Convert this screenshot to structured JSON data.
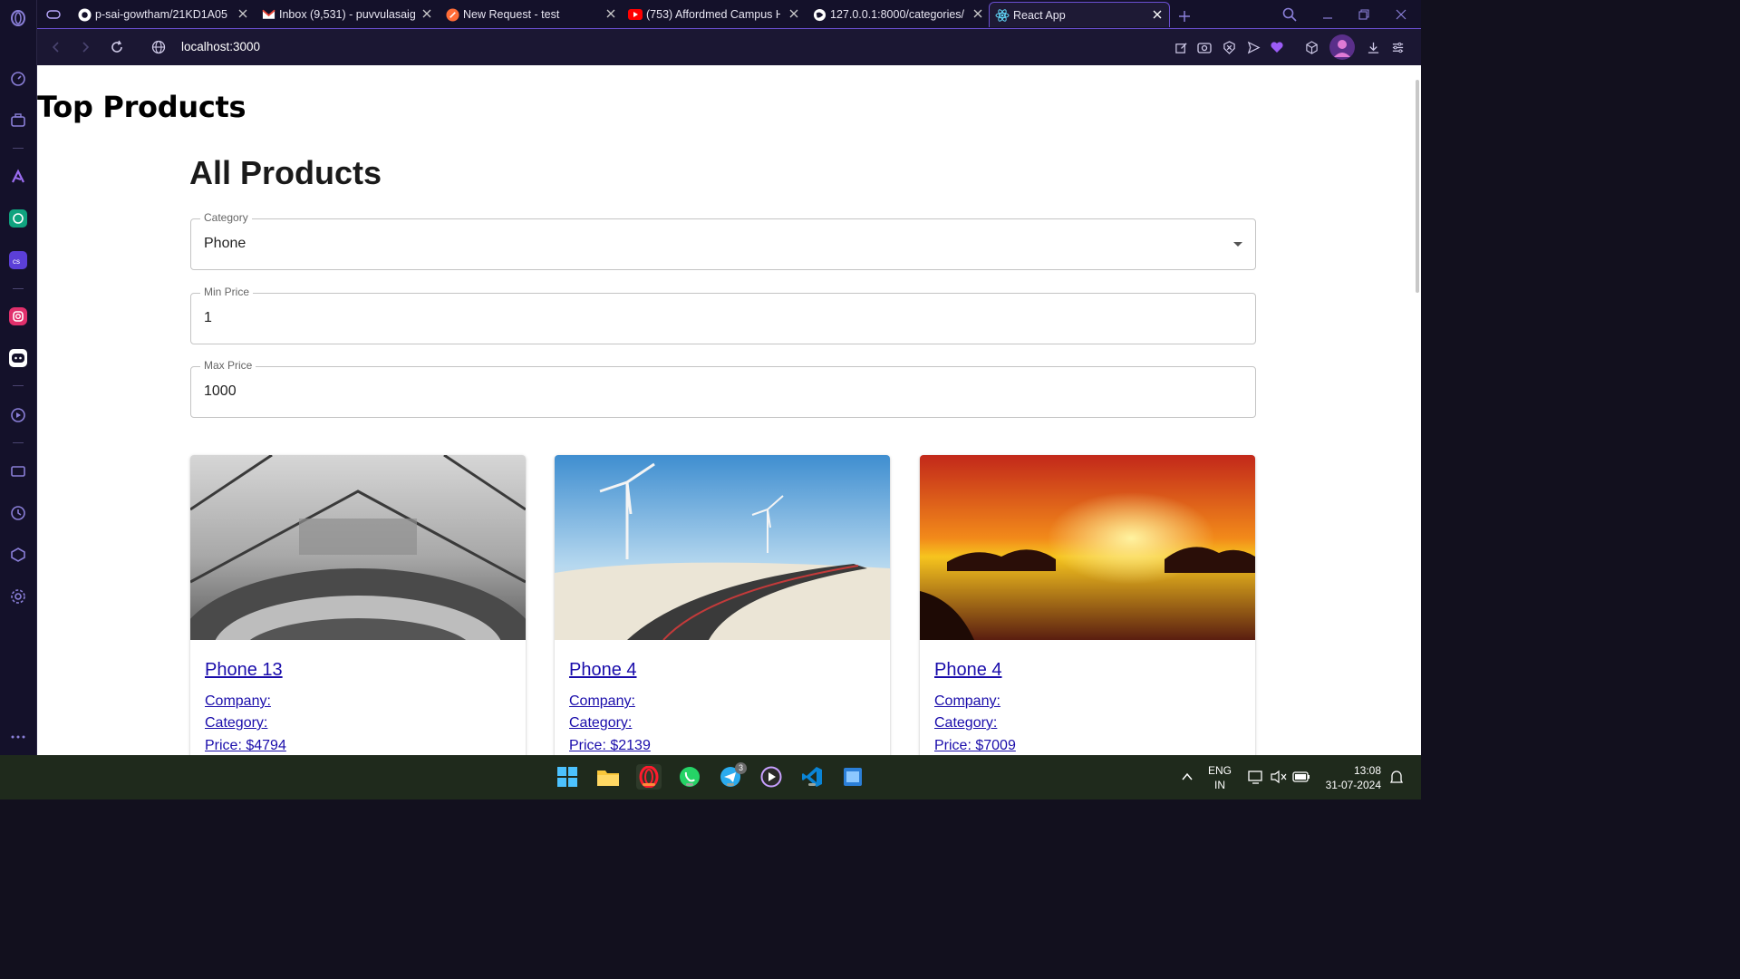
{
  "browser": {
    "tabs": [
      {
        "title": "p-sai-gowtham/21KD1A05",
        "icon": "github-icon"
      },
      {
        "title": "Inbox (9,531) - puvvulasaig",
        "icon": "gmail-icon"
      },
      {
        "title": "New Request - test",
        "icon": "postman-icon"
      },
      {
        "title": "(753) Affordmed Campus H",
        "icon": "youtube-icon"
      },
      {
        "title": "127.0.0.1:8000/categories/",
        "icon": "globe-icon"
      },
      {
        "title": "React App",
        "icon": "react-icon",
        "active": true
      }
    ],
    "url": "localhost:3000"
  },
  "page": {
    "heading": "Top Products",
    "section_title": "All Products",
    "filters": {
      "category": {
        "label": "Category",
        "value": "Phone"
      },
      "min_price": {
        "label": "Min Price",
        "value": "1"
      },
      "max_price": {
        "label": "Max Price",
        "value": "1000"
      }
    },
    "products": [
      {
        "name": "Phone 13",
        "company": "Company:",
        "category": "Category:",
        "price": "Price: $4794",
        "image": "city-view-photo"
      },
      {
        "name": "Phone 4",
        "company": "Company:",
        "category": "Category:",
        "price": "Price: $2139",
        "image": "wind-turbines-road-photo"
      },
      {
        "name": "Phone 4",
        "company": "Company:",
        "category": "Category:",
        "price": "Price: $7009",
        "image": "sunset-sea-photo"
      }
    ]
  },
  "taskbar": {
    "telegram_badge": "3",
    "lang_line1": "ENG",
    "lang_line2": "IN",
    "time": "13:08",
    "date": "31-07-2024"
  },
  "colors": {
    "link": "#1a0dab",
    "browser_bg": "#14112a",
    "accent": "#6a4fd0"
  }
}
